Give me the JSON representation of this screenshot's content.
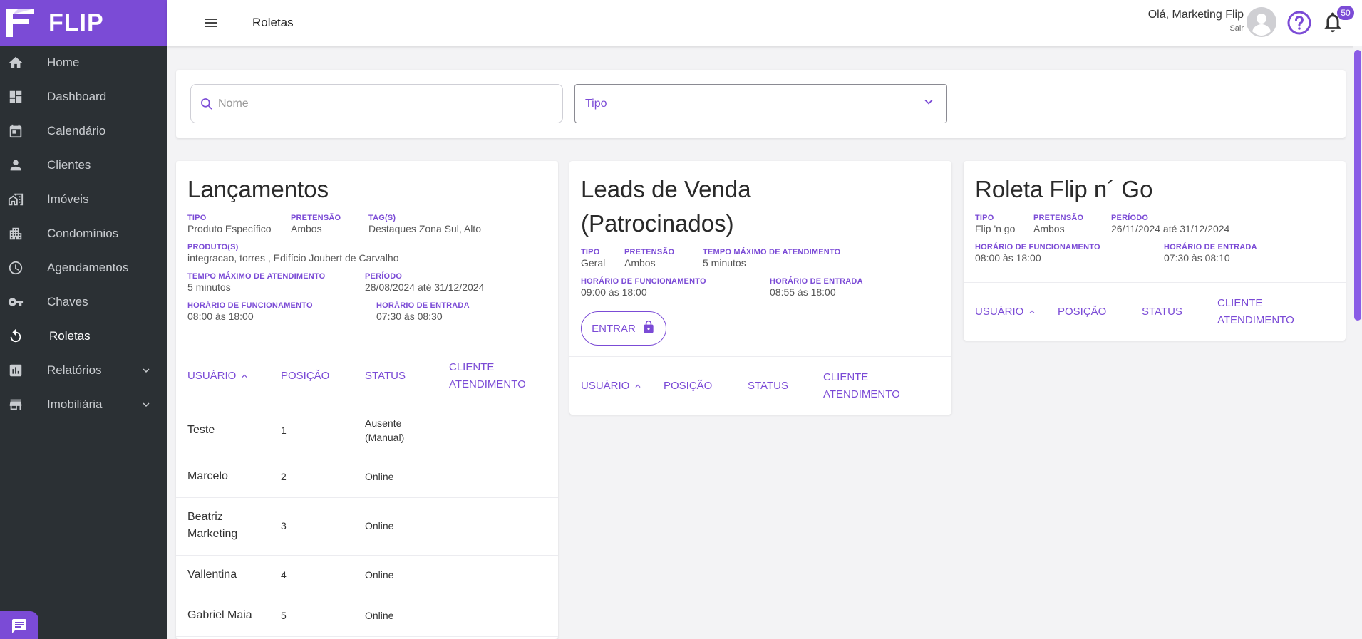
{
  "brand": {
    "name": "FLIP",
    "accent": "#7b4bd6",
    "sidebar_bg": "#2b3034"
  },
  "sidebar": {
    "items": [
      {
        "label": "Home",
        "icon": "home-icon"
      },
      {
        "label": "Dashboard",
        "icon": "dashboard-icon"
      },
      {
        "label": "Calendário",
        "icon": "calendar-icon"
      },
      {
        "label": "Clientes",
        "icon": "person-icon"
      },
      {
        "label": "Imóveis",
        "icon": "building-icon"
      },
      {
        "label": "Condomínios",
        "icon": "apartment-icon"
      },
      {
        "label": "Agendamentos",
        "icon": "clock-icon"
      },
      {
        "label": "Chaves",
        "icon": "key-icon"
      },
      {
        "label": "Roletas",
        "icon": "roulette-icon",
        "active": true
      },
      {
        "label": "Relatórios",
        "icon": "chart-icon",
        "expandable": true
      },
      {
        "label": "Imobiliária",
        "icon": "store-icon",
        "expandable": true
      }
    ]
  },
  "header": {
    "title": "Roletas",
    "greeting": "Olá, Marketing Flip",
    "logout": "Sair",
    "notifications_count": "50"
  },
  "filters": {
    "search_placeholder": "Nome",
    "type_label": "Tipo"
  },
  "cards": [
    {
      "title": "Lançamentos",
      "meta": {
        "tipo_label": "TIPO",
        "tipo": "Produto Específico",
        "pretensao_label": "PRETENSÃO",
        "pretensao": "Ambos",
        "tags_label": "TAG(S)",
        "tags": "Destaques Zona Sul, Alto",
        "produtos_label": "PRODUTO(S)",
        "produtos": "integracao, torres , Edifício Joubert de Carvalho",
        "tempo_label": "TEMPO MÁXIMO DE ATENDIMENTO",
        "tempo": "5 minutos",
        "periodo_label": "PERÍODO",
        "periodo": "28/08/2024 até 31/12/2024",
        "funcionamento_label": "HORÁRIO DE FUNCIONAMENTO",
        "funcionamento": "08:00 às 18:00",
        "entrada_label": "HORÁRIO DE ENTRADA",
        "entrada": "07:30 às 08:30"
      },
      "columns": [
        "USUÁRIO",
        "POSIÇÃO",
        "STATUS",
        "CLIENTE ATENDIMENTO"
      ],
      "rows": [
        {
          "usuario": "Teste",
          "posicao": "1",
          "status": "Ausente (Manual)"
        },
        {
          "usuario": "Marcelo",
          "posicao": "2",
          "status": "Online"
        },
        {
          "usuario": "Beatriz Marketing",
          "posicao": "3",
          "status": "Online"
        },
        {
          "usuario": "Vallentina",
          "posicao": "4",
          "status": "Online"
        },
        {
          "usuario": "Gabriel Maia",
          "posicao": "5",
          "status": "Online"
        }
      ]
    },
    {
      "title": "Leads de Venda (Patrocinados)",
      "meta": {
        "tipo_label": "TIPO",
        "tipo": "Geral",
        "pretensao_label": "PRETENSÃO",
        "pretensao": "Ambos",
        "tempo_label": "TEMPO MÁXIMO DE ATENDIMENTO",
        "tempo": "5 minutos",
        "funcionamento_label": "HORÁRIO DE FUNCIONAMENTO",
        "funcionamento": "09:00 às 18:00",
        "entrada_label": "HORÁRIO DE ENTRADA",
        "entrada": "08:55 às 18:00"
      },
      "enter_label": "ENTRAR",
      "columns": [
        "USUÁRIO",
        "POSIÇÃO",
        "STATUS",
        "CLIENTE ATENDIMENTO"
      ]
    },
    {
      "title": "Roleta Flip n´ Go",
      "meta": {
        "tipo_label": "TIPO",
        "tipo": "Flip 'n go",
        "pretensao_label": "PRETENSÃO",
        "pretensao": "Ambos",
        "periodo_label": "PERÍODO",
        "periodo": "26/11/2024 até 31/12/2024",
        "funcionamento_label": "HORÁRIO DE FUNCIONAMENTO",
        "funcionamento": "08:00 às 18:00",
        "entrada_label": "HORÁRIO DE ENTRADA",
        "entrada": "07:30 às 08:10"
      },
      "columns": [
        "USUÁRIO",
        "POSIÇÃO",
        "STATUS",
        "CLIENTE ATENDIMENTO"
      ]
    }
  ]
}
